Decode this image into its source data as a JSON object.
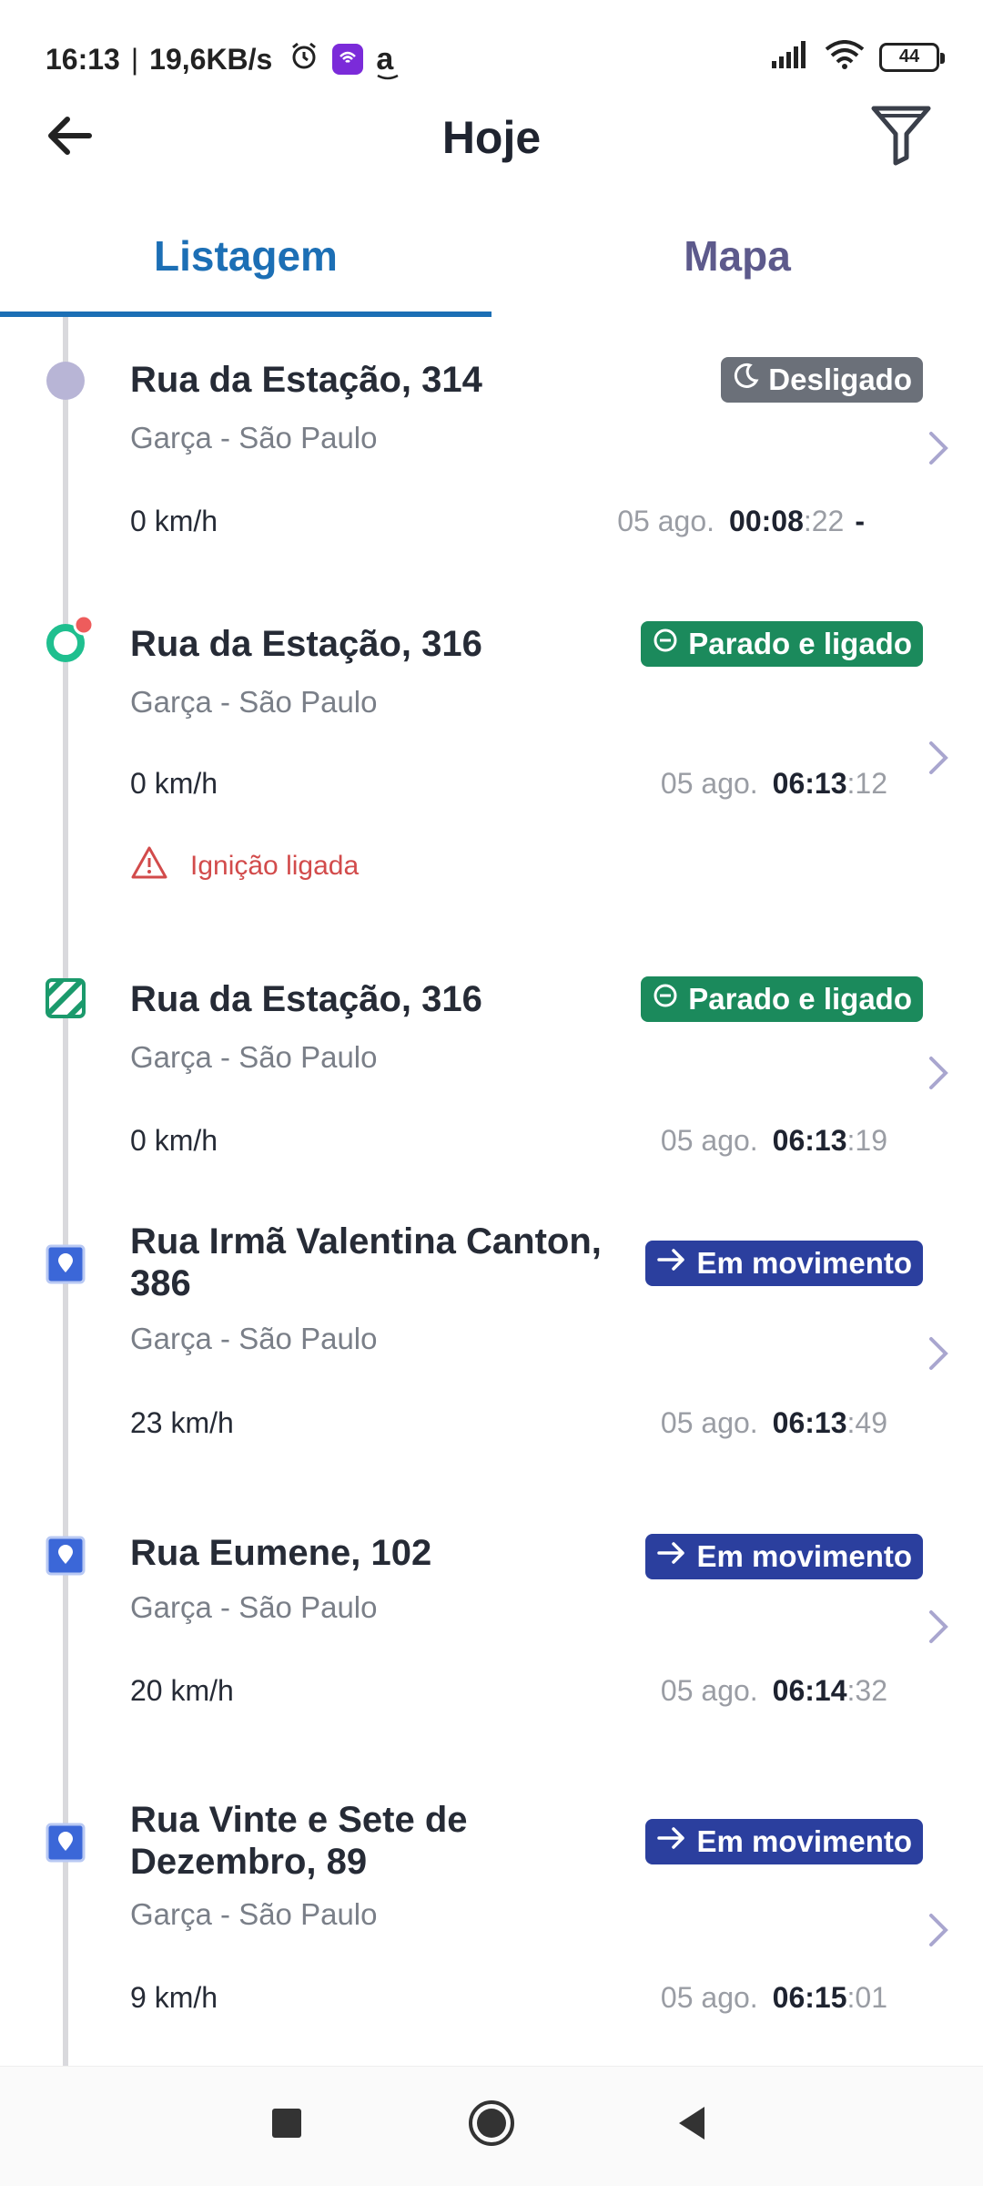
{
  "status_bar": {
    "time": "16:13",
    "network_speed": "19,6KB/s",
    "separator": "|",
    "amazon_glyph": "a",
    "battery": "44",
    "icons": [
      "alarm-icon",
      "app-notification-icon",
      "amazon-icon",
      "signal-icon",
      "wifi-icon",
      "battery-icon"
    ]
  },
  "header": {
    "title": "Hoje",
    "back_icon": "arrow-left-icon",
    "filter_icon": "funnel-icon"
  },
  "tabs": [
    {
      "label": "Listagem",
      "active": true
    },
    {
      "label": "Mapa",
      "active": false
    }
  ],
  "colors": {
    "accent": "#1c6fb5",
    "off": "#6b7079",
    "stopped_on": "#1b8a5c",
    "moving": "#2b3f9e",
    "alert": "#d24b4b"
  },
  "items": [
    {
      "street": "Rua da Estação, 314",
      "city": "Garça - São Paulo",
      "speed": "0 km/h",
      "date": "05 ago.",
      "time_hm": "00:08",
      "time_s": ":22",
      "time_suffix": "-",
      "status": "Desligado",
      "status_icon": "moon-icon",
      "marker": "circle-off"
    },
    {
      "street": "Rua da Estação, 316",
      "city": "Garça - São Paulo",
      "speed": "0 km/h",
      "date": "05 ago.",
      "time_hm": "06:13",
      "time_s": ":12",
      "status": "Parado e ligado",
      "status_icon": "minus-circle-icon",
      "marker": "ring-with-dot",
      "alert": "Ignição ligada"
    },
    {
      "street": "Rua da Estação, 316",
      "city": "Garça - São Paulo",
      "speed": "0 km/h",
      "date": "05 ago.",
      "time_hm": "06:13",
      "time_s": ":19",
      "status": "Parado e ligado",
      "status_icon": "minus-circle-icon",
      "marker": "striped-square"
    },
    {
      "street": "Rua Irmã Valentina Canton, 386",
      "city": "Garça - São Paulo",
      "speed": "23 km/h",
      "date": "05 ago.",
      "time_hm": "06:13",
      "time_s": ":49",
      "status": "Em movimento",
      "status_icon": "arrow-right-icon",
      "marker": "pin-square"
    },
    {
      "street": "Rua Eumene, 102",
      "city": "Garça - São Paulo",
      "speed": "20 km/h",
      "date": "05 ago.",
      "time_hm": "06:14",
      "time_s": ":32",
      "status": "Em movimento",
      "status_icon": "arrow-right-icon",
      "marker": "pin-square"
    },
    {
      "street": "Rua Vinte e Sete de Dezembro, 89",
      "city": "Garça - São Paulo",
      "speed": "9 km/h",
      "date": "05 ago.",
      "time_hm": "06:15",
      "time_s": ":01",
      "status": "Em movimento",
      "status_icon": "arrow-right-icon",
      "marker": "pin-square"
    }
  ],
  "navbar": {
    "icons": [
      "recent-apps-icon",
      "home-icon",
      "back-icon"
    ]
  }
}
